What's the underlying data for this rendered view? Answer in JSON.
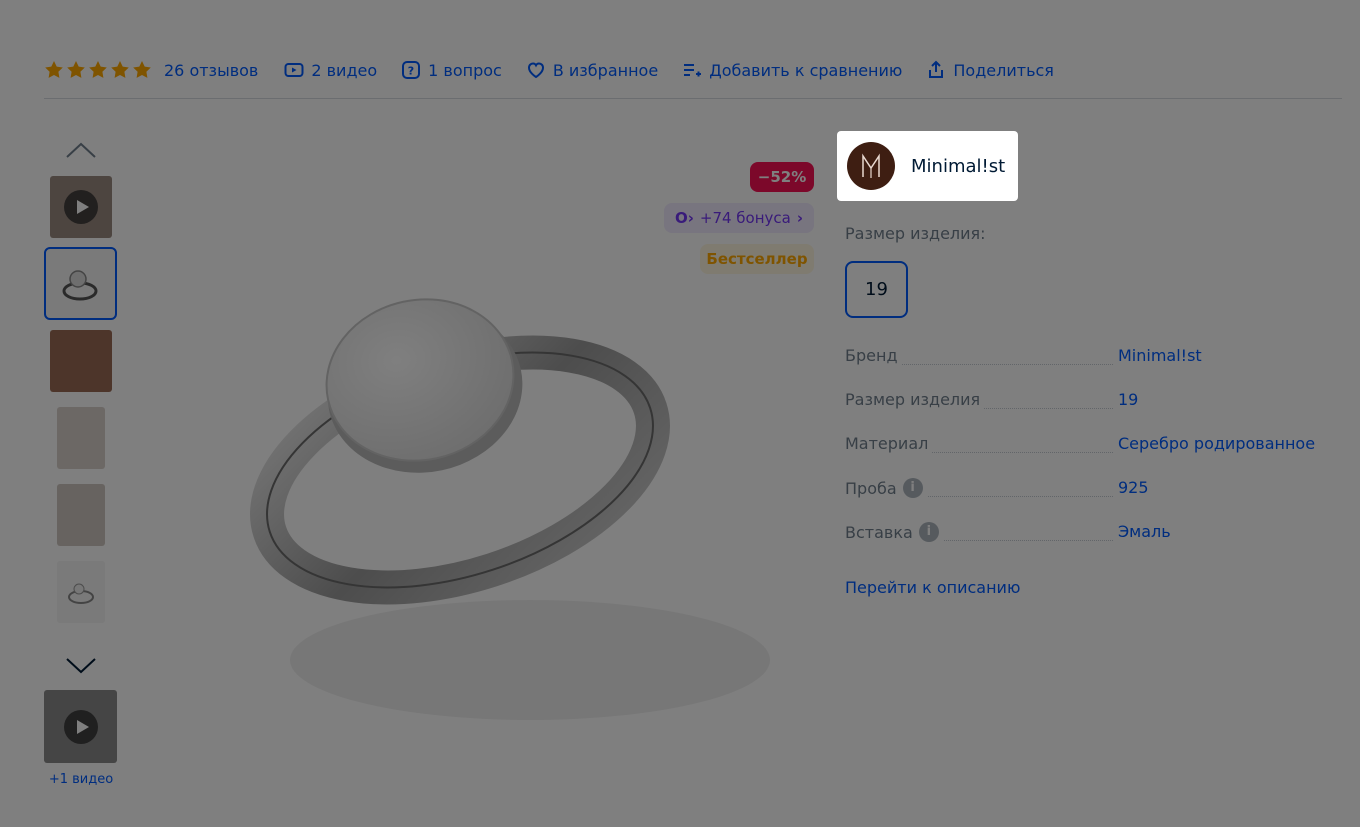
{
  "topbar": {
    "rating_stars": 5,
    "reviews_label": "26 отзывов",
    "video_label": "2 видео",
    "question_label": "1 вопрос",
    "favorite_label": "В избранное",
    "compare_label": "Добавить к сравнению",
    "share_label": "Поделиться"
  },
  "gallery": {
    "more_video_label": "+1 видео"
  },
  "badges": {
    "discount": "−52%",
    "bonus": "+74 бонуса",
    "bestseller": "Бестселлер"
  },
  "brand_card": {
    "name": "Minimal!st",
    "logo_letter": "M"
  },
  "size": {
    "label": "Размер изделия:",
    "selected": "19"
  },
  "specs": [
    {
      "key": "Бренд",
      "value": "Minimal!st",
      "info": false
    },
    {
      "key": "Размер изделия",
      "value": "19",
      "info": false
    },
    {
      "key": "Материал",
      "value": "Серебро родированное",
      "info": false
    },
    {
      "key": "Проба",
      "value": "925",
      "info": true
    },
    {
      "key": "Вставка",
      "value": "Эмаль",
      "info": true
    }
  ],
  "goto_description": "Перейти к описанию",
  "colors": {
    "link": "#005bff",
    "discount_bg": "#f91155",
    "bonus_fg": "#7336f5",
    "bestseller_fg": "#ffa800",
    "star": "#ffa800"
  }
}
